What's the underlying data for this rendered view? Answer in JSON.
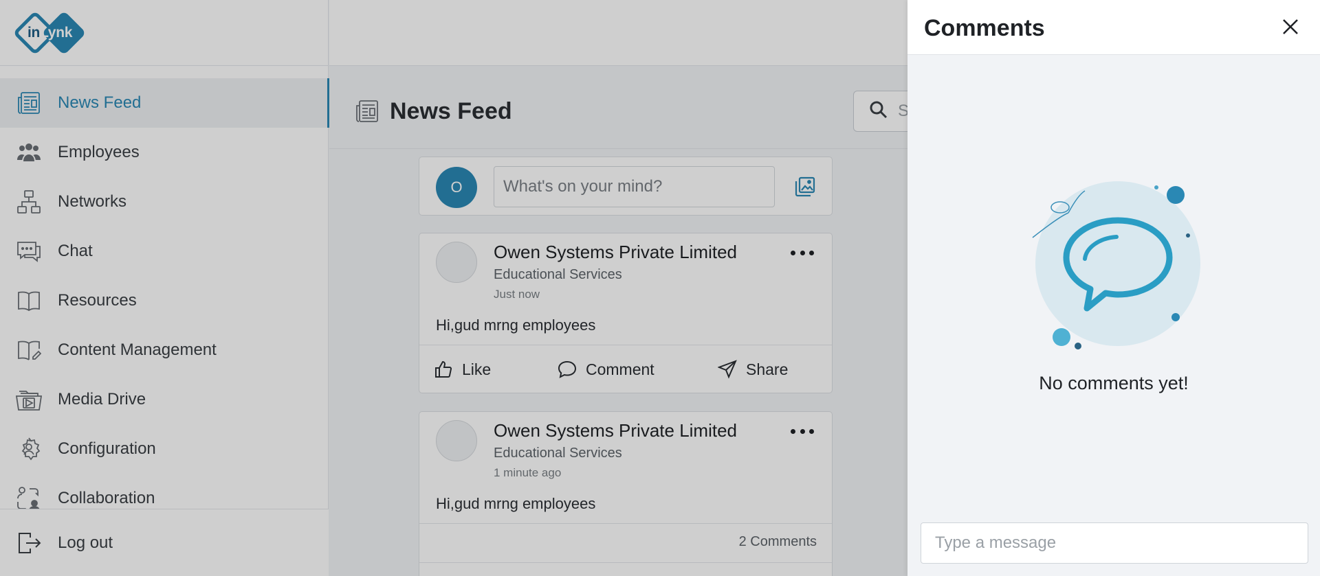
{
  "app": {
    "logo_text_a": "in",
    "logo_text_b": "Lynk"
  },
  "sidebar": {
    "items": [
      {
        "label": "News Feed",
        "icon": "newspaper-icon",
        "active": true
      },
      {
        "label": "Employees",
        "icon": "people-icon"
      },
      {
        "label": "Networks",
        "icon": "network-icon"
      },
      {
        "label": "Chat",
        "icon": "chat-icon"
      },
      {
        "label": "Resources",
        "icon": "book-icon"
      },
      {
        "label": "Content Management",
        "icon": "book-edit-icon"
      },
      {
        "label": "Media Drive",
        "icon": "media-folder-icon"
      },
      {
        "label": "Configuration",
        "icon": "gear-person-icon"
      },
      {
        "label": "Collaboration",
        "icon": "collaboration-icon"
      }
    ],
    "logout_label": "Log out"
  },
  "header": {
    "title": "News Feed",
    "search_placeholder": "S"
  },
  "composer": {
    "avatar_initial": "O",
    "placeholder": "What's on your mind?"
  },
  "posts": [
    {
      "author": "Owen Systems Private Limited",
      "category": "Educational Services",
      "time": "Just now",
      "text": "Hi,gud mrng employees",
      "actions": {
        "like": "Like",
        "comment": "Comment",
        "share": "Share"
      }
    },
    {
      "author": "Owen Systems Private Limited",
      "category": "Educational Services",
      "time": "1 minute ago",
      "text": "Hi,gud mrng employees",
      "comments_count": "2 Comments"
    }
  ],
  "comments_panel": {
    "title": "Comments",
    "empty_text": "No comments yet!",
    "input_placeholder": "Type a message"
  },
  "colors": {
    "accent": "#2a88b4",
    "overlay": "rgba(0,0,0,0.19)"
  }
}
